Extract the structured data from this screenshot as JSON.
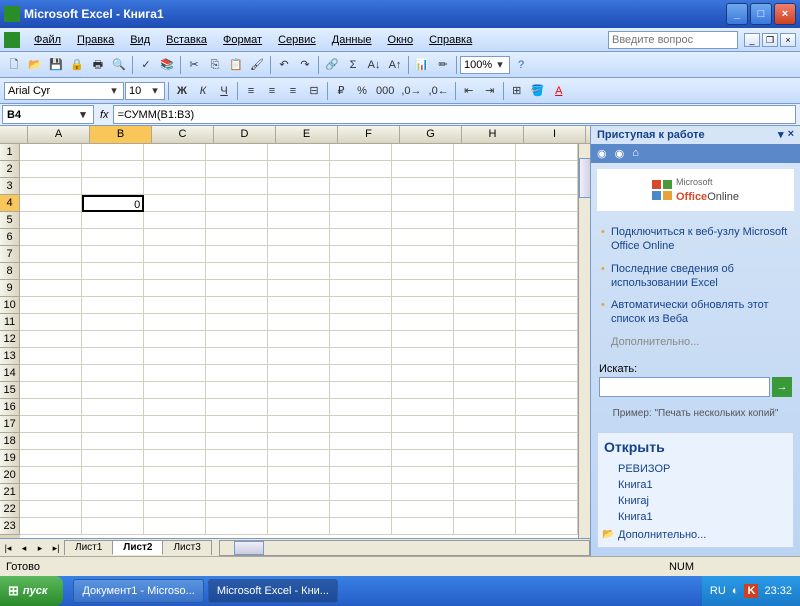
{
  "window": {
    "title": "Microsoft Excel - Книга1"
  },
  "menu": {
    "items": [
      "Файл",
      "Правка",
      "Вид",
      "Вставка",
      "Формат",
      "Сервис",
      "Данные",
      "Окно",
      "Справка"
    ],
    "question_placeholder": "Введите вопрос"
  },
  "format_toolbar": {
    "font": "Arial Cyr",
    "size": "10",
    "zoom": "100%"
  },
  "formula_bar": {
    "cell_ref": "B4",
    "fx": "fx",
    "formula": "=СУММ(B1:B3)"
  },
  "grid": {
    "columns": [
      "A",
      "B",
      "C",
      "D",
      "E",
      "F",
      "G",
      "H",
      "I"
    ],
    "rows": 23,
    "selected": {
      "row": 4,
      "col": "B",
      "value": "0"
    }
  },
  "sheets": {
    "tabs": [
      "Лист1",
      "Лист2",
      "Лист3"
    ],
    "active": 1
  },
  "taskpane": {
    "title": "Приступая к работе",
    "online_label_ms": "Microsoft",
    "online_label_office": "Office",
    "online_label_on": "Online",
    "links": [
      "Подключиться к веб-узлу Microsoft Office Online",
      "Последние сведения об использовании Excel",
      "Автоматически обновлять этот список из Веба"
    ],
    "more": "Дополнительно...",
    "search_label": "Искать:",
    "example": "Пример: \"Печать нескольких копий\"",
    "open_title": "Открыть",
    "recent": [
      "РЕВИЗОР",
      "Книга1",
      "Книгај",
      "Книга1"
    ],
    "open_more": "Дополнительно..."
  },
  "status": {
    "ready": "Готово",
    "num": "NUM"
  },
  "taskbar": {
    "start": "пуск",
    "apps": [
      "Документ1 - Microso...",
      "Microsoft Excel - Кни..."
    ],
    "lang": "RU",
    "time": "23:32"
  }
}
